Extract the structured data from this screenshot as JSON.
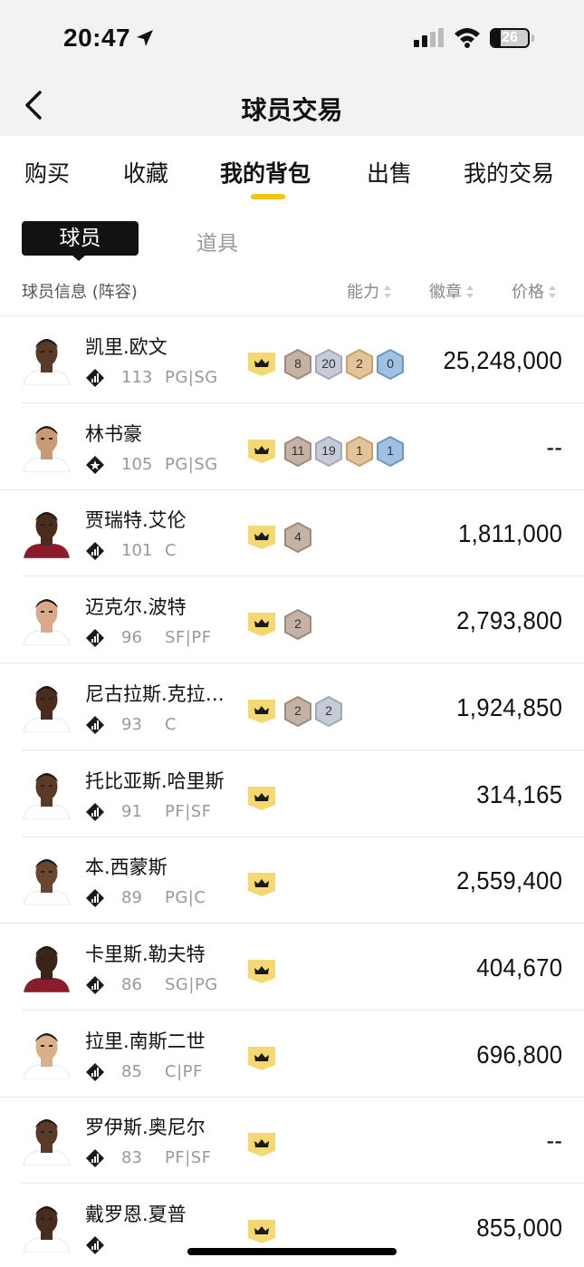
{
  "status_bar": {
    "time": "20:47",
    "battery": "26"
  },
  "nav": {
    "title": "球员交易"
  },
  "tabs": [
    {
      "label": "购买",
      "active": false
    },
    {
      "label": "收藏",
      "active": false
    },
    {
      "label": "我的背包",
      "active": true
    },
    {
      "label": "出售",
      "active": false
    },
    {
      "label": "我的交易",
      "active": false
    }
  ],
  "sub_tabs": [
    {
      "label": "球员",
      "active": true
    },
    {
      "label": "道具",
      "active": false
    }
  ],
  "table_header": {
    "info": "球员信息 (阵容)",
    "ability": "能力",
    "badges": "徽章",
    "price": "价格"
  },
  "colors": {
    "accent": "#f4c21a",
    "crown_bg": "#f6d873"
  },
  "players": [
    {
      "name": "凯里.欧文",
      "rating": "113",
      "position": "PG|SG",
      "badges": [
        "8",
        "20",
        "2",
        "0"
      ],
      "price": "25,248,000",
      "skin": "#5a3a26",
      "jersey": "#ffffff"
    },
    {
      "name": "林书豪",
      "rating": "105",
      "position": "PG|SG",
      "badges": [
        "11",
        "19",
        "1",
        "1"
      ],
      "price": "--",
      "skin": "#c99a74",
      "jersey": "#ffffff"
    },
    {
      "name": "贾瑞特.艾伦",
      "rating": "101",
      "position": "C",
      "badges": [
        "4"
      ],
      "price": "1,811,000",
      "skin": "#4a2c1c",
      "jersey": "#8b1c2c"
    },
    {
      "name": "迈克尔.波特",
      "rating": "96",
      "position": "SF|PF",
      "badges": [
        "2"
      ],
      "price": "2,793,800",
      "skin": "#d9a98a",
      "jersey": "#ffffff"
    },
    {
      "name": "尼古拉斯.克拉克斯顿",
      "rating": "93",
      "position": "C",
      "badges": [
        "2",
        "2"
      ],
      "price": "1,924,850",
      "skin": "#4a2c1c",
      "jersey": "#ffffff"
    },
    {
      "name": "托比亚斯.哈里斯",
      "rating": "91",
      "position": "PF|SF",
      "badges": [],
      "price": "314,165",
      "skin": "#5a3a26",
      "jersey": "#ffffff"
    },
    {
      "name": "本.西蒙斯",
      "rating": "89",
      "position": "PG|C",
      "badges": [],
      "price": "2,559,400",
      "skin": "#6a4530",
      "jersey": "#ffffff"
    },
    {
      "name": "卡里斯.勒夫特",
      "rating": "86",
      "position": "SG|PG",
      "badges": [],
      "price": "404,670",
      "skin": "#3a2418",
      "jersey": "#8b1c2c"
    },
    {
      "name": "拉里.南斯二世",
      "rating": "85",
      "position": "C|PF",
      "badges": [],
      "price": "696,800",
      "skin": "#d9b08a",
      "jersey": "#ffffff"
    },
    {
      "name": "罗伊斯.奥尼尔",
      "rating": "83",
      "position": "PF|SF",
      "badges": [],
      "price": "--",
      "skin": "#5a3a26",
      "jersey": "#ffffff"
    },
    {
      "name": "戴罗恩.夏普",
      "rating": "",
      "position": "",
      "badges": [],
      "price": "855,000",
      "skin": "#4a2c1c",
      "jersey": "#ffffff"
    }
  ]
}
